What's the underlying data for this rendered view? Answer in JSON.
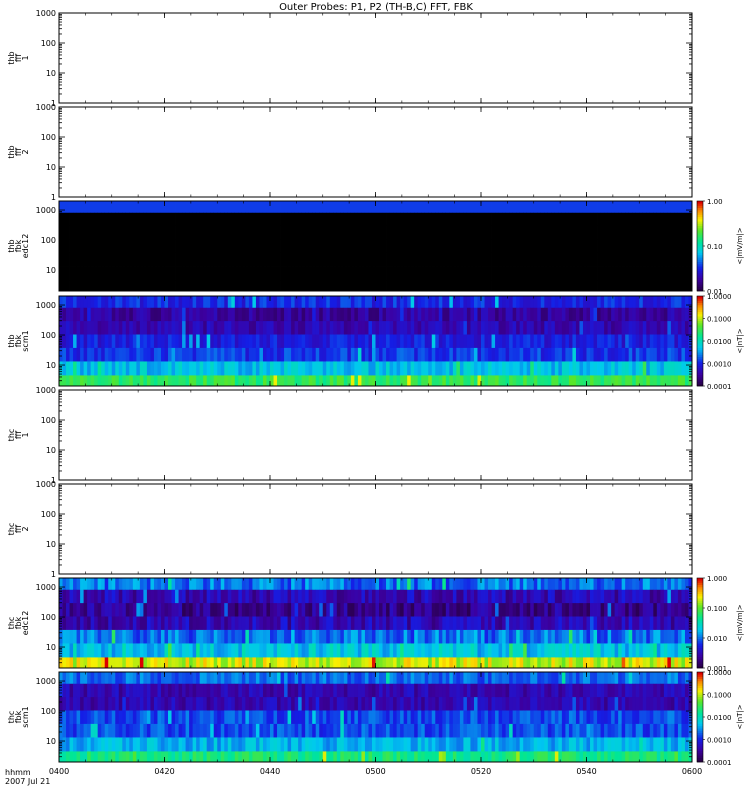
{
  "title": "Outer Probes: P1, P2 (TH-B,C) FFT, FBK",
  "colors": {
    "frame": "#000000",
    "background": "#ffffff"
  },
  "x_axis": {
    "label_line1": "hhmm",
    "label_line2": "2007 Jul 21",
    "ticks": [
      "0400",
      "0420",
      "0440",
      "0500",
      "0520",
      "0540",
      "0600"
    ]
  },
  "panels": [
    {
      "label": [
        "thb",
        "fff",
        "1"
      ],
      "yticks": [
        "1",
        "10",
        "100",
        "1000"
      ],
      "kind": "empty"
    },
    {
      "label": [
        "thb",
        "fff",
        "2"
      ],
      "yticks": [
        "1",
        "10",
        "100",
        "1000"
      ],
      "kind": "empty"
    },
    {
      "label": [
        "thb",
        "fbk",
        "edc12"
      ],
      "yticks": [
        "10",
        "100",
        "1000"
      ],
      "kind": "spec-black",
      "colorbar": {
        "ticks": [
          "1.00",
          "0.10",
          "0.01"
        ],
        "label": "<|mV/m|>"
      }
    },
    {
      "label": [
        "thb",
        "fbk",
        "scm1"
      ],
      "yticks": [
        "10",
        "100",
        "1000"
      ],
      "kind": "spec",
      "colorbar": {
        "ticks": [
          "1.0000",
          "0.1000",
          "0.0100",
          "0.0010",
          "0.0001"
        ],
        "label": "<|nT|>"
      }
    },
    {
      "label": [
        "thc",
        "fff",
        "1"
      ],
      "yticks": [
        "1",
        "10",
        "100",
        "1000"
      ],
      "kind": "empty"
    },
    {
      "label": [
        "thc",
        "fff",
        "2"
      ],
      "yticks": [
        "1",
        "10",
        "100",
        "1000"
      ],
      "kind": "empty"
    },
    {
      "label": [
        "thc",
        "fbk",
        "edc12"
      ],
      "yticks": [
        "10",
        "100",
        "1000"
      ],
      "kind": "spec",
      "colorbar": {
        "ticks": [
          "1.000",
          "0.100",
          "0.010",
          "0.001"
        ],
        "label": "<|mV/m|>"
      }
    },
    {
      "label": [
        "thc",
        "fbk",
        "scm1"
      ],
      "yticks": [
        "10",
        "100",
        "1000"
      ],
      "kind": "spec",
      "colorbar": {
        "ticks": [
          "1.0000",
          "0.1000",
          "0.0100",
          "0.0010",
          "0.0001"
        ],
        "label": "<|nT|>"
      }
    }
  ],
  "chart_data": [
    {
      "type": "heatmap",
      "ylabel": "thb fff 1",
      "yscale": "log",
      "ylim": [
        1,
        1000
      ],
      "xrange": [
        "0400",
        "0600"
      ],
      "values": []
    },
    {
      "type": "heatmap",
      "ylabel": "thb fff 2",
      "yscale": "log",
      "ylim": [
        1,
        1000
      ],
      "xrange": [
        "0400",
        "0600"
      ],
      "values": []
    },
    {
      "type": "heatmap",
      "ylabel": "thb fbk edc12",
      "yscale": "log",
      "xrange": [
        "0400",
        "0600"
      ],
      "colorbar": {
        "label": "<|mV/m|>",
        "range": [
          0.01,
          1.0
        ]
      },
      "bands_hz": [
        2.7,
        8,
        23,
        64,
        180,
        500,
        1400
      ],
      "description_levels": "near zero (below scale) in all bands except top band ~0.03"
    },
    {
      "type": "heatmap",
      "ylabel": "thb fbk scm1",
      "yscale": "log",
      "xrange": [
        "0400",
        "0600"
      ],
      "colorbar": {
        "label": "<|nT|>",
        "range": [
          0.0001,
          1.0
        ]
      },
      "bands_hz": [
        2.7,
        8,
        23,
        64,
        180,
        500,
        1400
      ],
      "band_levels_nT": [
        0.03,
        0.005,
        0.0012,
        0.0008,
        0.0004,
        0.0003,
        0.001
      ]
    },
    {
      "type": "heatmap",
      "ylabel": "thc fff 1",
      "yscale": "log",
      "ylim": [
        1,
        1000
      ],
      "xrange": [
        "0400",
        "0600"
      ],
      "values": []
    },
    {
      "type": "heatmap",
      "ylabel": "thc fff 2",
      "yscale": "log",
      "ylim": [
        1,
        1000
      ],
      "xrange": [
        "0400",
        "0600"
      ],
      "values": []
    },
    {
      "type": "heatmap",
      "ylabel": "thc fbk edc12",
      "yscale": "log",
      "xrange": [
        "0400",
        "0600"
      ],
      "colorbar": {
        "label": "<|mV/m|>",
        "range": [
          0.001,
          1.0
        ]
      },
      "bands_hz": [
        2.7,
        8,
        23,
        64,
        180,
        500,
        1400
      ],
      "band_levels_mVm": [
        0.2,
        0.02,
        0.01,
        0.003,
        0.002,
        0.003,
        0.01
      ]
    },
    {
      "type": "heatmap",
      "ylabel": "thc fbk scm1",
      "yscale": "log",
      "xrange": [
        "0400",
        "0600"
      ],
      "colorbar": {
        "label": "<|nT|>",
        "range": [
          0.0001,
          1.0
        ]
      },
      "bands_hz": [
        2.7,
        8,
        23,
        64,
        180,
        500,
        1400
      ],
      "band_levels_nT": [
        0.02,
        0.004,
        0.0015,
        0.0015,
        0.0004,
        0.0004,
        0.002
      ]
    }
  ]
}
